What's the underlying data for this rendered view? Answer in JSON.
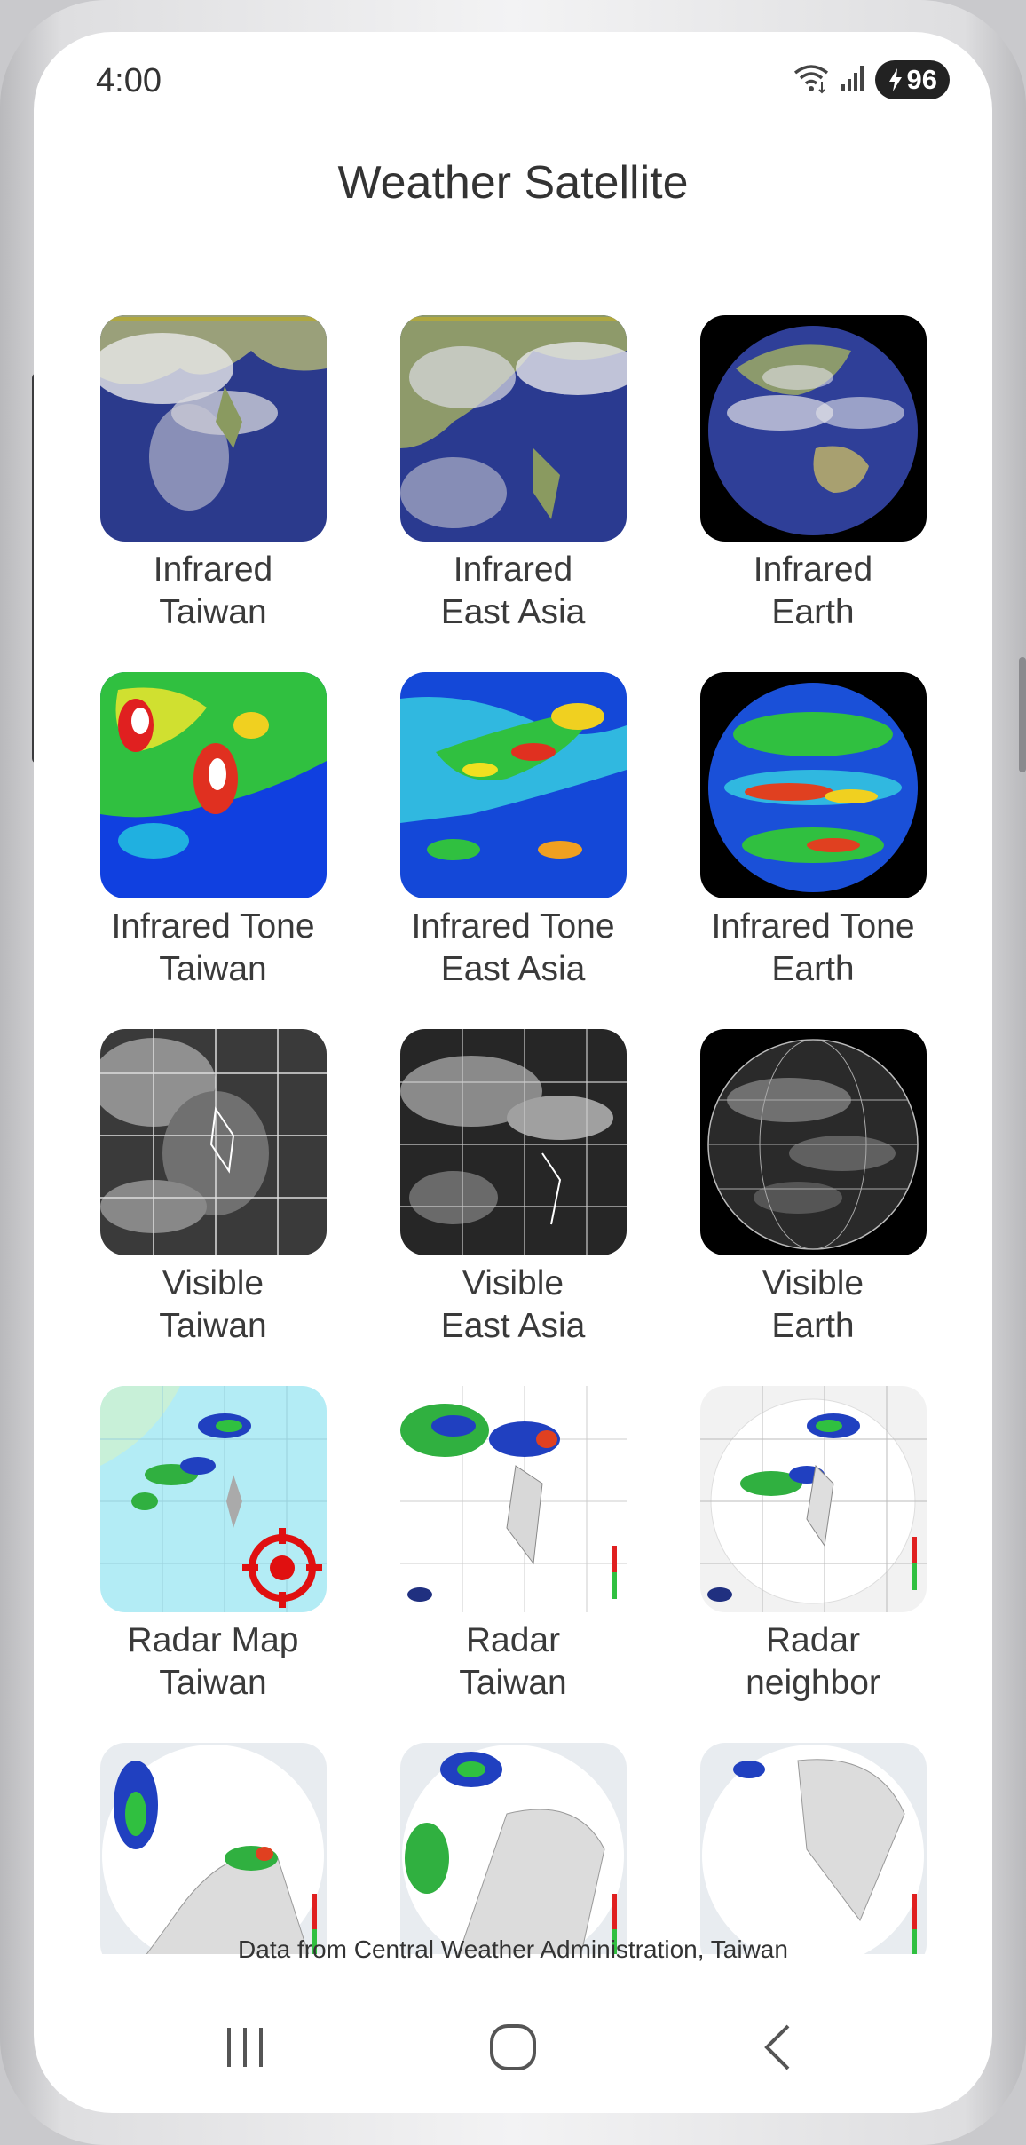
{
  "status_bar": {
    "time": "4:00",
    "battery_level": "96",
    "icons": [
      "wifi-icon",
      "signal-icon",
      "battery-charging-icon"
    ]
  },
  "header": {
    "title": "Weather Satellite"
  },
  "tiles": [
    {
      "line1": "Infrared",
      "line2": "Taiwan",
      "icon": "infrared-taiwan-thumbnail"
    },
    {
      "line1": "Infrared",
      "line2": "East Asia",
      "icon": "infrared-east-asia-thumbnail"
    },
    {
      "line1": "Infrared",
      "line2": "Earth",
      "icon": "infrared-earth-thumbnail"
    },
    {
      "line1": "Infrared Tone",
      "line2": "Taiwan",
      "icon": "infrared-tone-taiwan-thumbnail"
    },
    {
      "line1": "Infrared Tone",
      "line2": "East Asia",
      "icon": "infrared-tone-east-asia-thumbnail"
    },
    {
      "line1": "Infrared Tone",
      "line2": "Earth",
      "icon": "infrared-tone-earth-thumbnail"
    },
    {
      "line1": "Visible",
      "line2": "Taiwan",
      "icon": "visible-taiwan-thumbnail"
    },
    {
      "line1": "Visible",
      "line2": "East Asia",
      "icon": "visible-east-asia-thumbnail"
    },
    {
      "line1": "Visible",
      "line2": "Earth",
      "icon": "visible-earth-thumbnail"
    },
    {
      "line1": "Radar Map",
      "line2": "Taiwan",
      "icon": "radar-map-taiwan-thumbnail"
    },
    {
      "line1": "Radar",
      "line2": "Taiwan",
      "icon": "radar-taiwan-thumbnail"
    },
    {
      "line1": "Radar",
      "line2": "neighbor",
      "icon": "radar-neighbor-thumbnail"
    },
    {
      "line1": "",
      "line2": "",
      "icon": "radar-north-thumbnail"
    },
    {
      "line1": "",
      "line2": "",
      "icon": "radar-central-thumbnail"
    },
    {
      "line1": "",
      "line2": "",
      "icon": "radar-south-thumbnail"
    }
  ],
  "footer": {
    "text": "Data from Central Weather Administration, Taiwan"
  },
  "nav": [
    "recent-apps-icon",
    "home-icon",
    "back-icon"
  ]
}
